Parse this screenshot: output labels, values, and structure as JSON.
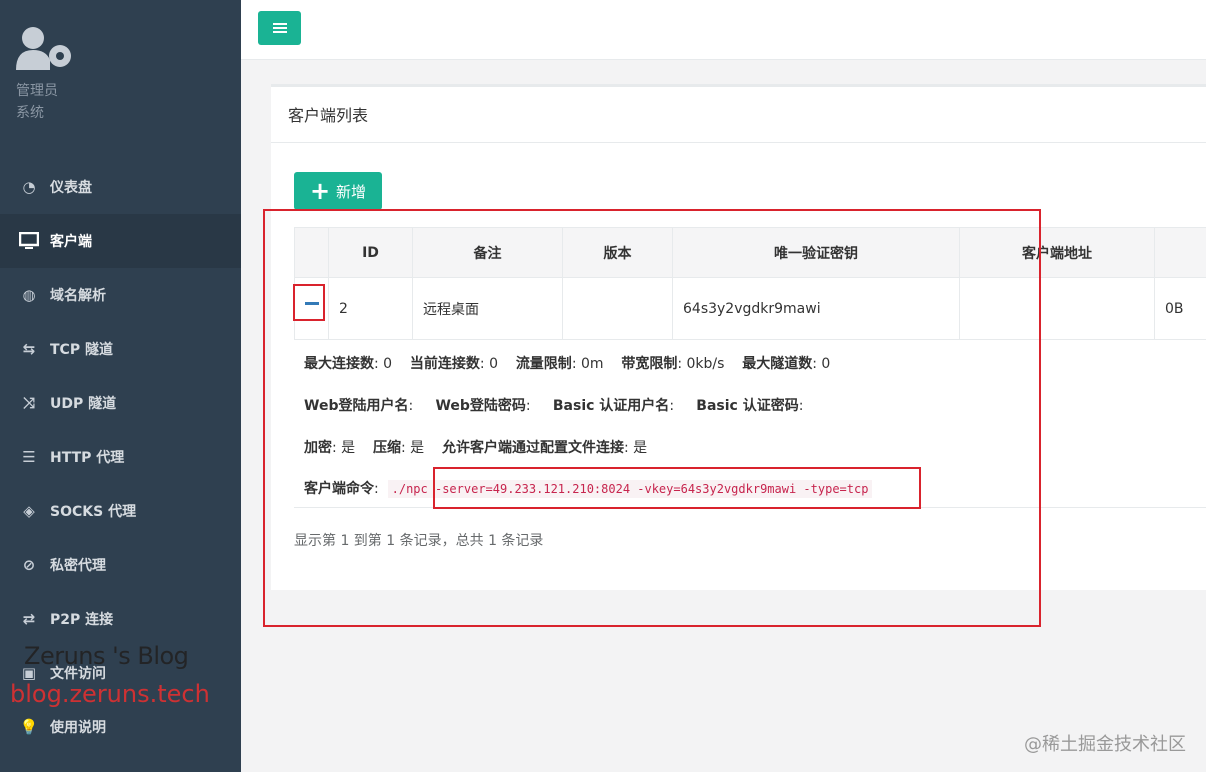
{
  "sidebar": {
    "user_role": "管理员",
    "user_group": "系统",
    "items": [
      {
        "label": "仪表盘",
        "icon": "dashboard-icon"
      },
      {
        "label": "客户端",
        "icon": "monitor-icon",
        "active": true
      },
      {
        "label": "域名解析",
        "icon": "globe-icon"
      },
      {
        "label": "TCP 隧道",
        "icon": "retweet-icon"
      },
      {
        "label": "UDP 隧道",
        "icon": "random-icon"
      },
      {
        "label": "HTTP 代理",
        "icon": "server-icon"
      },
      {
        "label": "SOCKS 代理",
        "icon": "layers-icon"
      },
      {
        "label": "私密代理",
        "icon": "eye-slash-icon"
      },
      {
        "label": "P2P 连接",
        "icon": "exchange-icon"
      },
      {
        "label": "文件访问",
        "icon": "briefcase-icon"
      },
      {
        "label": "使用说明",
        "icon": "lightbulb-icon"
      }
    ]
  },
  "watermark": {
    "line1": "Zeruns 's Blog",
    "line2": "blog.zeruns.tech"
  },
  "panel": {
    "title": "客户端列表",
    "add_label": "新增"
  },
  "table": {
    "headers": [
      "ID",
      "备注",
      "版本",
      "唯一验证密钥",
      "客户端地址"
    ],
    "row": {
      "id": "2",
      "remark": "远程桌面",
      "version": "",
      "vkey": "64s3y2vgdkr9mawi",
      "addr": "",
      "traffic": "0B"
    }
  },
  "detail": {
    "max_conn_label": "最大连接数",
    "max_conn": "0",
    "cur_conn_label": "当前连接数",
    "cur_conn": "0",
    "flow_limit_label": "流量限制",
    "flow_limit": "0m",
    "bw_limit_label": "带宽限制",
    "bw_limit": "0kb/s",
    "max_tunnel_label": "最大隧道数",
    "max_tunnel": "0",
    "web_user_label": "Web登陆用户名",
    "web_pass_label": "Web登陆密码",
    "basic_user_label": "Basic 认证用户名",
    "basic_pass_label": "Basic 认证密码",
    "encrypt_label": "加密",
    "encrypt": "是",
    "compress_label": "压缩",
    "compress": "是",
    "config_conn_label": "允许客户端通过配置文件连接",
    "config_conn": "是",
    "cmd_label": "客户端命令",
    "cmd": "./npc -server=49.233.121.210:8024 -vkey=64s3y2vgdkr9mawi -type=tcp"
  },
  "summary": "显示第 1 到第 1 条记录，总共 1 条记录",
  "footer": "@稀土掘金技术社区",
  "colors": {
    "sidebar": "#2f4050",
    "accent": "#1ab394",
    "highlight": "#d9232d"
  }
}
